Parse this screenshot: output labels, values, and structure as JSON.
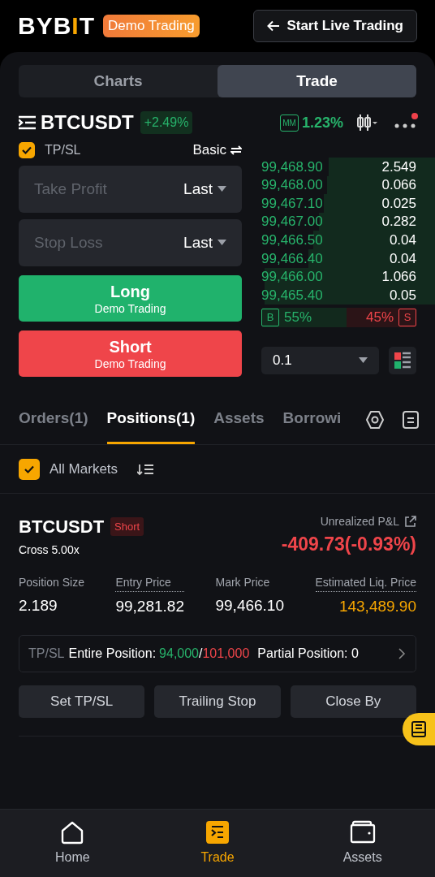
{
  "header": {
    "logo": {
      "head": "BYB",
      "accent": "I",
      "tail": "T"
    },
    "badge": "Demo Trading",
    "live_button": "Start Live Trading"
  },
  "view_tabs": [
    {
      "label": "Charts",
      "selected": false
    },
    {
      "label": "Trade",
      "selected": true
    }
  ],
  "symbol": {
    "name": "BTCUSDT",
    "change": "+2.49%",
    "mm_label": "MM",
    "mm_ratio": "1.23%",
    "notification": true
  },
  "order_form": {
    "tpsl": {
      "label": "TP/SL",
      "checked": true
    },
    "mode": "Basic",
    "fields": [
      {
        "placeholder": "Take Profit",
        "trigger": "Last"
      },
      {
        "placeholder": "Stop Loss",
        "trigger": "Last"
      }
    ],
    "buttons": [
      {
        "kind": "long",
        "label": "Long",
        "sub": "Demo Trading"
      },
      {
        "kind": "short",
        "label": "Short",
        "sub": "Demo Trading"
      }
    ]
  },
  "order_book": {
    "rows": [
      {
        "price": "99,468.90",
        "qty": "2.549"
      },
      {
        "price": "99,468.00",
        "qty": "0.066"
      },
      {
        "price": "99,467.10",
        "qty": "0.025"
      },
      {
        "price": "99,467.00",
        "qty": "0.282"
      },
      {
        "price": "99,466.50",
        "qty": "0.04"
      },
      {
        "price": "99,466.40",
        "qty": "0.04"
      },
      {
        "price": "99,466.00",
        "qty": "1.066"
      },
      {
        "price": "99,465.40",
        "qty": "0.05"
      }
    ],
    "ratio": {
      "buy_label": "B",
      "buy": "55%",
      "sell": "45%",
      "sell_label": "S",
      "level": 0.55
    },
    "step": "0.1"
  },
  "bottom_tabs": [
    {
      "label": "Orders(1)",
      "selected": false
    },
    {
      "label": "Positions(1)",
      "selected": true
    },
    {
      "label": "Assets",
      "selected": false
    },
    {
      "label": "Borrowi",
      "selected": false
    }
  ],
  "filter": {
    "label": "All Markets",
    "checked": true
  },
  "position": {
    "symbol": "BTCUSDT",
    "side": "Short",
    "margin": "Cross 5.00x",
    "pnl_label": "Unrealized P&L",
    "pnl": "-409.73(-0.93%)",
    "stats": [
      {
        "label": "Position Size",
        "value": "2.189",
        "hint": false,
        "highlight": false
      },
      {
        "label": "Entry Price",
        "value": "99,281.82",
        "hint": true,
        "highlight": false
      },
      {
        "label": "Mark Price",
        "value": "99,466.10",
        "hint": false,
        "highlight": false
      },
      {
        "label": "Estimated Liq. Price",
        "value": "143,489.90",
        "hint": true,
        "highlight": true
      }
    ],
    "tpsl": {
      "label": "TP/SL",
      "entire": "Entire Position:",
      "tp": "94,000",
      "sep": "/",
      "sl": "101,000",
      "partial": "Partial Position: 0"
    },
    "actions": [
      "Set TP/SL",
      "Trailing Stop",
      "Close By"
    ]
  },
  "nav": [
    {
      "label": "Home",
      "selected": false
    },
    {
      "label": "Trade",
      "selected": true
    },
    {
      "label": "Assets",
      "selected": false
    }
  ]
}
